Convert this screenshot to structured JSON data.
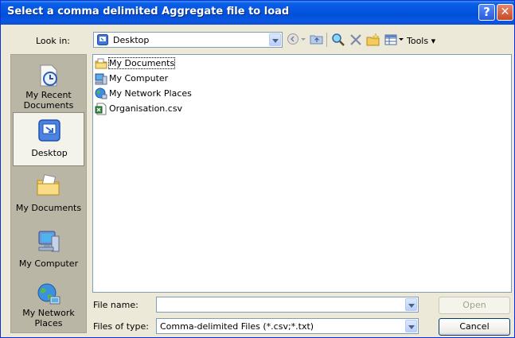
{
  "window": {
    "title": "Select a comma delimited Aggregate file to load",
    "help_glyph": "?",
    "close_glyph": "✕"
  },
  "toolbar": {
    "look_in_label": "Look in:",
    "look_in_value": "Desktop",
    "tools_label": "Tools ▾",
    "icons": [
      "back-icon",
      "up-folder-icon",
      "search-web-icon",
      "delete-icon",
      "new-folder-icon",
      "views-icon"
    ]
  },
  "places": [
    {
      "label": "My Recent Documents",
      "icon": "recent-documents-icon",
      "selected": false
    },
    {
      "label": "Desktop",
      "icon": "desktop-icon",
      "selected": true
    },
    {
      "label": "My Documents",
      "icon": "my-documents-icon",
      "selected": false
    },
    {
      "label": "My Computer",
      "icon": "my-computer-icon",
      "selected": false
    },
    {
      "label": "My Network Places",
      "icon": "network-places-icon",
      "selected": false
    }
  ],
  "files": [
    {
      "name": "My Documents",
      "icon": "folder-icon"
    },
    {
      "name": "My Computer",
      "icon": "computer-icon"
    },
    {
      "name": "My Network Places",
      "icon": "network-icon"
    },
    {
      "name": "Organisation.csv",
      "icon": "csv-file-icon"
    }
  ],
  "footer": {
    "file_name_label": "File name:",
    "file_name_value": "",
    "files_of_type_label": "Files of type:",
    "files_of_type_value": "Comma-delimited Files (*.csv;*.txt)",
    "open_label": "Open",
    "cancel_label": "Cancel"
  },
  "colors": {
    "titlebar": "#0454e0",
    "dialog_bg": "#ece9d8",
    "places_bg": "#bab6a6"
  }
}
